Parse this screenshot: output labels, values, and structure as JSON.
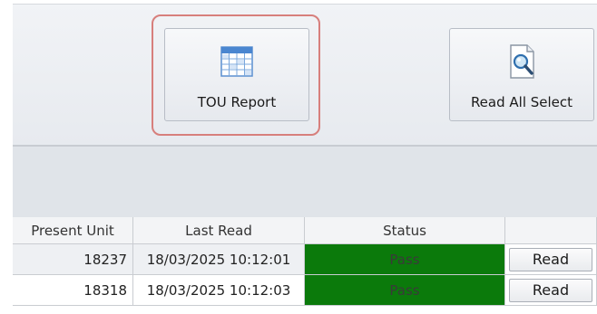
{
  "ribbon": {
    "tou_report_label": "TOU Report",
    "read_all_select_label": "Read All Select"
  },
  "grid": {
    "headers": [
      "Present Unit",
      "Last Read",
      "Status",
      ""
    ],
    "rows": [
      {
        "present_unit": "18237",
        "last_read": "18/03/2025 10:12:01",
        "status": "Pass",
        "action": "Read"
      },
      {
        "present_unit": "18318",
        "last_read": "18/03/2025 10:12:03",
        "status": "Pass",
        "action": "Read"
      }
    ]
  },
  "colors": {
    "status_pass": "#0b7a0b",
    "highlight_border": "#d77f7c"
  },
  "icons": {
    "tou_report": "table-grid-icon",
    "read_all_select": "document-search-icon"
  }
}
